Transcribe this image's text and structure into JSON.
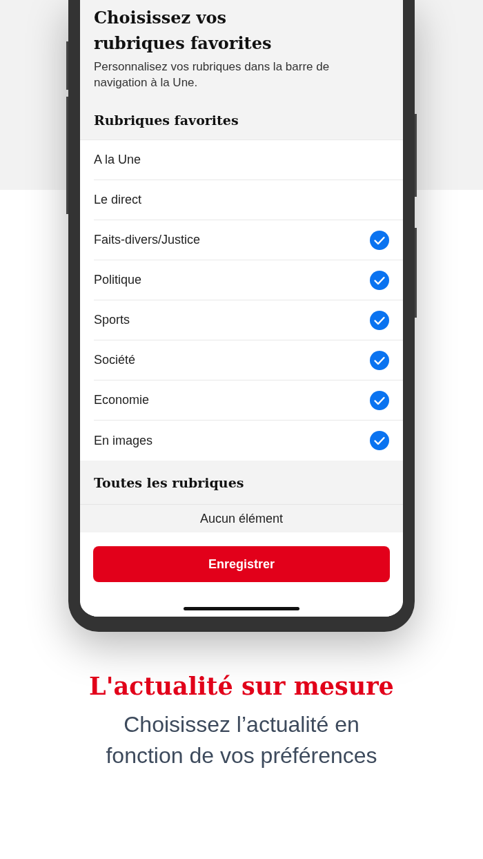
{
  "screen": {
    "title": "Choisissez vos rubriques favorites",
    "subtitle": "Personnalisez vos rubriques dans la barre de navigation à la Une.",
    "favorites_header": "Rubriques favorites",
    "favorites": [
      {
        "label": "A la Une",
        "checked": false
      },
      {
        "label": "Le direct",
        "checked": false
      },
      {
        "label": "Faits-divers/Justice",
        "checked": true
      },
      {
        "label": "Politique",
        "checked": true
      },
      {
        "label": "Sports",
        "checked": true
      },
      {
        "label": "Société",
        "checked": true
      },
      {
        "label": "Economie",
        "checked": true
      },
      {
        "label": "En images",
        "checked": true
      }
    ],
    "all_header": "Toutes les rubriques",
    "empty_message": "Aucun élément",
    "save_button": "Enregistrer"
  },
  "tagline": {
    "title": "L'actualité sur mesure",
    "subtitle": "Choisissez l’actualité en fonction de vos préférences"
  }
}
